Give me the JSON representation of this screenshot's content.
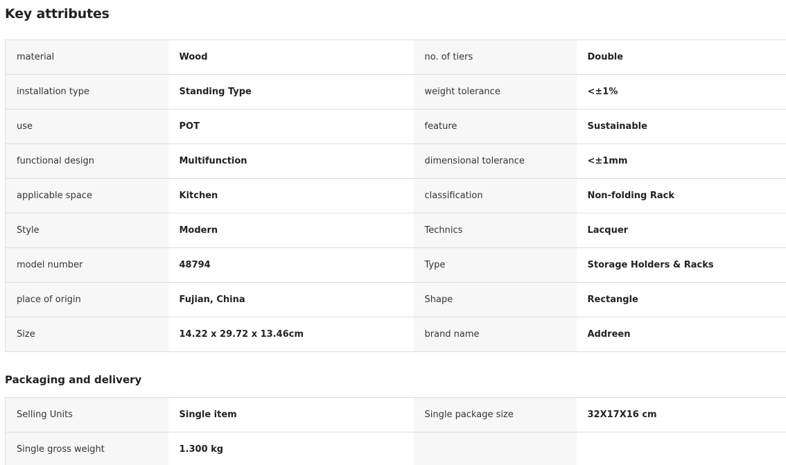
{
  "key_attributes": {
    "title": "Key attributes",
    "rows": [
      [
        "material",
        "Wood",
        "no. of tiers",
        "Double"
      ],
      [
        "installation type",
        "Standing Type",
        "weight tolerance",
        "<±1%"
      ],
      [
        "use",
        "POT",
        "feature",
        "Sustainable"
      ],
      [
        "functional design",
        "Multifunction",
        "dimensional tolerance",
        "<±1mm"
      ],
      [
        "applicable space",
        "Kitchen",
        "classification",
        "Non-folding Rack"
      ],
      [
        "Style",
        "Modern",
        "Technics",
        "Lacquer"
      ],
      [
        "model number",
        "48794",
        "Type",
        "Storage Holders & Racks"
      ],
      [
        "place of origin",
        "Fujian, China",
        "Shape",
        "Rectangle"
      ],
      [
        "Size",
        "14.22 x 29.72 x 13.46cm",
        "brand name",
        "Addreen"
      ]
    ]
  },
  "packaging": {
    "title": "Packaging and delivery",
    "rows": [
      [
        "Selling Units",
        "Single item",
        "Single package size",
        "32X17X16 cm"
      ],
      [
        "Single gross weight",
        "1.300 kg",
        "",
        ""
      ]
    ]
  }
}
